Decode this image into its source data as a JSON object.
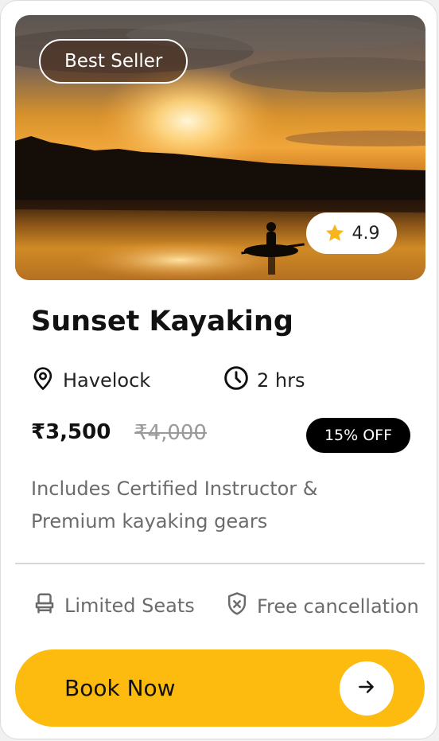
{
  "card": {
    "badge": "Best Seller",
    "rating": "4.9",
    "title": "Sunset Kayaking",
    "location": "Havelock",
    "duration": "2 hrs",
    "price": "₹3,500",
    "old_price": "₹4,000",
    "discount": "15% OFF",
    "description": "Includes Certified Instructor & Premium kayaking gears",
    "features": {
      "seats": "Limited Seats",
      "cancellation": "Free cancellation"
    },
    "cta": "Book Now"
  },
  "colors": {
    "accent": "#fdbb0f",
    "star": "#f6b51b",
    "discount_bg": "#000000"
  },
  "icons": {
    "location": "location-pin-icon",
    "duration": "clock-icon",
    "seats": "seat-icon",
    "cancellation": "shield-x-icon",
    "rating": "star-icon",
    "cta": "arrow-right-icon"
  }
}
